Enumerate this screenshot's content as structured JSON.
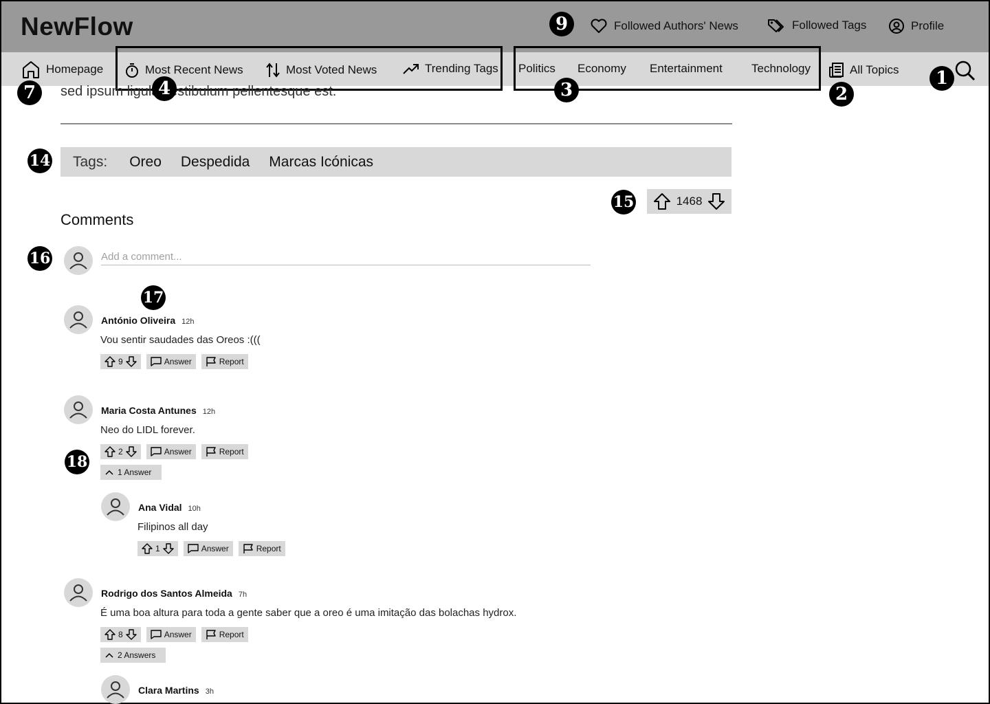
{
  "app": {
    "brand": "NewFlow"
  },
  "top_nav": {
    "followed_authors": "Followed Authors' News",
    "followed_tags": "Followed Tags",
    "profile": "Profile"
  },
  "nav": {
    "homepage": "Homepage",
    "most_recent": "Most Recent News",
    "most_voted": "Most Voted News",
    "trending_tags": "Trending Tags",
    "topics": [
      "Politics",
      "Economy",
      "Entertainment",
      "Technology"
    ],
    "all_topics": "All Topics"
  },
  "annotations": {
    "n1": "1",
    "n2": "2",
    "n3": "3",
    "n4": "4",
    "n7": "7",
    "n9": "9",
    "n14": "14",
    "n15": "15",
    "n16": "16",
    "n17": "17",
    "n18": "18"
  },
  "article": {
    "body_fragment": "sed ipsum ligula vestibulum pellentesque est.",
    "tags_label": "Tags:",
    "tags": [
      "Oreo",
      "Despedida",
      "Marcas Icónicas"
    ],
    "votes": "1468"
  },
  "comments": {
    "title": "Comments",
    "placeholder": "Add a comment...",
    "answer_label": "Answer",
    "report_label": "Report",
    "items": [
      {
        "author": "António Oliveira",
        "time": "12h",
        "text": "Vou sentir saudades das Oreos :(((",
        "votes": "9"
      },
      {
        "author": "Maria Costa Antunes",
        "time": "12h",
        "text": "Neo do LIDL forever.",
        "votes": "2",
        "replies_toggle": "1 Answer"
      },
      {
        "author": "Ana Vidal",
        "time": "10h",
        "text": "Filipinos all day",
        "votes": "1"
      },
      {
        "author": "Rodrigo dos Santos Almeida",
        "time": "7h",
        "text": "É uma boa altura para toda a gente saber que a oreo é uma imitação das bolachas hydrox.",
        "votes": "8",
        "replies_toggle": "2 Answers"
      },
      {
        "author": "Clara Martins",
        "time": "3h"
      }
    ]
  },
  "colors": {
    "topbar": "#999999",
    "navbar": "#d8d8d8",
    "badge": "#000000"
  }
}
